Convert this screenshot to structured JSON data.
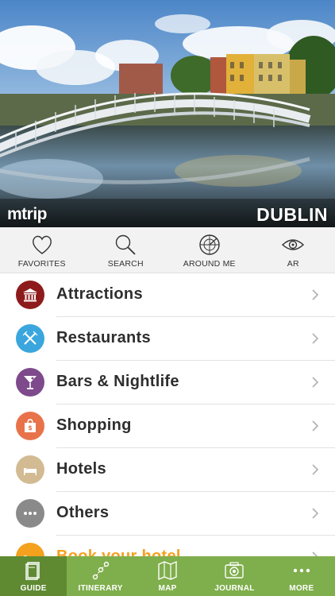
{
  "hero": {
    "brand": "mtrip",
    "city": "DUBLIN"
  },
  "quickbar": [
    {
      "label": "FAVORITES",
      "icon": "heart-icon"
    },
    {
      "label": "SEARCH",
      "icon": "search-icon"
    },
    {
      "label": "AROUND ME",
      "icon": "radar-icon"
    },
    {
      "label": "AR",
      "icon": "eye-icon"
    }
  ],
  "categories": [
    {
      "label": "Attractions",
      "icon": "museum-icon",
      "color": "#8e1b1b"
    },
    {
      "label": "Restaurants",
      "icon": "fork-knife-icon",
      "color": "#3aa6dd"
    },
    {
      "label": "Bars & Nightlife",
      "icon": "cocktail-icon",
      "color": "#7e4a8c"
    },
    {
      "label": "Shopping",
      "icon": "shopping-bag-icon",
      "color": "#e8734a"
    },
    {
      "label": "Hotels",
      "icon": "bed-icon",
      "color": "#d2bb93"
    },
    {
      "label": "Others",
      "icon": "dots-icon",
      "color": "#8a8a8a"
    },
    {
      "label": "Book your hotel",
      "icon": "hotel-booking-icon",
      "color": "#f4a11e"
    }
  ],
  "tabbar": [
    {
      "label": "GUIDE",
      "icon": "guide-book-icon",
      "active": true
    },
    {
      "label": "ITINERARY",
      "icon": "route-icon",
      "active": false
    },
    {
      "label": "MAP",
      "icon": "map-icon",
      "active": false
    },
    {
      "label": "JOURNAL",
      "icon": "camera-icon",
      "active": false
    },
    {
      "label": "MORE",
      "icon": "more-dots-icon",
      "active": false
    }
  ],
  "colors": {
    "tabbar": "#7fae4c",
    "tabbar_active": "#5f8a32",
    "accent": "#f4a11e"
  }
}
